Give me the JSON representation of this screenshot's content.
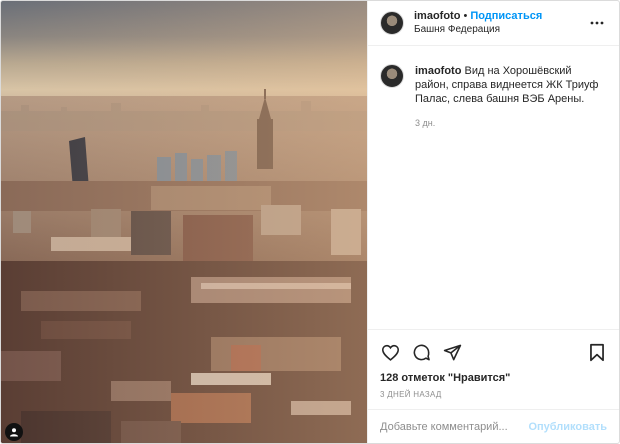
{
  "post": {
    "username": "imaofoto",
    "follow_label": "Подписаться",
    "location": "Башня Федерация",
    "caption_user": "imaofoto",
    "caption_text": "Вид на Хорошёвский район, справа виднеется ЖК Триуф Палас, слева башня ВЭБ Арены.",
    "caption_time": "3 дн.",
    "likes": "128 отметок \"Нравится\"",
    "date": "3 ДНЕЙ НАЗАД",
    "comment_placeholder": "Добавьте комментарий...",
    "publish_label": "Опубликовать"
  },
  "icons": {
    "more": "more-options-icon",
    "like": "heart-icon",
    "comment": "comment-icon",
    "share": "share-icon",
    "save": "bookmark-icon"
  },
  "colors": {
    "link_blue": "#0095f6",
    "publish_disabled": "#b2dffc",
    "muted": "#8e8e8e"
  }
}
